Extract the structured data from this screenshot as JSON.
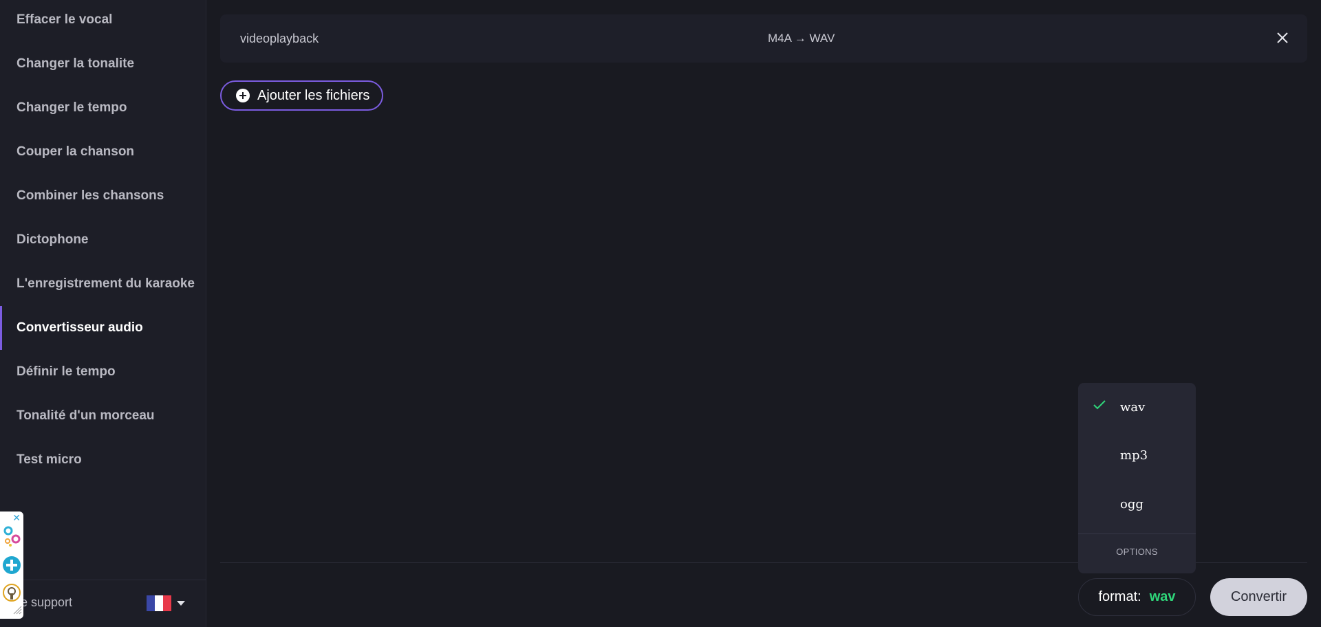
{
  "sidebar": {
    "items": [
      {
        "label": "Effacer le vocal"
      },
      {
        "label": "Changer la tonalite"
      },
      {
        "label": "Changer le tempo"
      },
      {
        "label": "Couper la chanson"
      },
      {
        "label": "Combiner les chansons"
      },
      {
        "label": "Dictophone"
      },
      {
        "label": "L'enregistrement du karaoke"
      },
      {
        "label": "Convertisseur audio"
      },
      {
        "label": "Définir le tempo"
      },
      {
        "label": "Tonalité d'un morceau"
      },
      {
        "label": "Test micro"
      }
    ],
    "active_item": "Convertisseur audio",
    "footer": {
      "support_label": "e support",
      "language_icon": "flag-fr-icon"
    }
  },
  "ad_widget": {
    "close_label": "✕"
  },
  "file": {
    "name": "videoplayback",
    "conversion": "M4A → WAV"
  },
  "actions": {
    "add_files_label": "Ajouter les fichiers",
    "convert_label": "Convertir"
  },
  "format_menu": {
    "options": [
      {
        "label": "wav",
        "selected": true
      },
      {
        "label": "mp3",
        "selected": false
      },
      {
        "label": "ogg",
        "selected": false
      }
    ],
    "options_label": "OPTIONS"
  },
  "format_selector": {
    "label": "format:",
    "value": "wav"
  },
  "colors": {
    "accent": "#7b5ce0",
    "format_value": "#2fd67a",
    "background": "#191a21"
  }
}
